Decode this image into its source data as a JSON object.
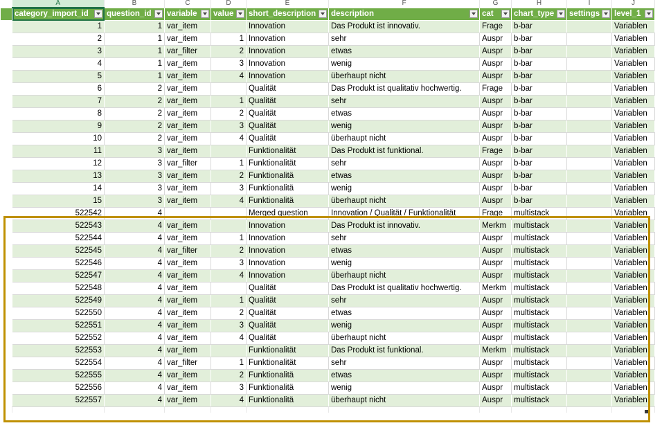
{
  "column_letters": [
    "A",
    "B",
    "C",
    "D",
    "E",
    "F",
    "G",
    "H",
    "I",
    "J"
  ],
  "headers": [
    "category_import_id",
    "question_id",
    "variable",
    "value",
    "short_description",
    "description",
    "cat",
    "chart_type",
    "settings",
    "level_1"
  ],
  "row_numbers": [
    "",
    "",
    "",
    "",
    "",
    "",
    "",
    "",
    ")",
    "",
    "",
    "",
    "",
    "",
    "",
    "",
    ""
  ],
  "rows": [
    {
      "category_import_id": "1",
      "question_id": "1",
      "variable": "var_item",
      "value": "",
      "short_description": "Innovation",
      "description": "Das Produkt ist innovativ.",
      "cat": "Frage",
      "chart_type": "b-bar",
      "settings": "",
      "level_1": "Variablen"
    },
    {
      "category_import_id": "2",
      "question_id": "1",
      "variable": "var_item",
      "value": "1",
      "short_description": "Innovation",
      "description": "sehr",
      "cat": "Auspr",
      "chart_type": "b-bar",
      "settings": "",
      "level_1": "Variablen"
    },
    {
      "category_import_id": "3",
      "question_id": "1",
      "variable": "var_filter",
      "value": "2",
      "short_description": "Innovation",
      "description": "etwas",
      "cat": "Auspr",
      "chart_type": "b-bar",
      "settings": "",
      "level_1": "Variablen"
    },
    {
      "category_import_id": "4",
      "question_id": "1",
      "variable": "var_item",
      "value": "3",
      "short_description": "Innovation",
      "description": "wenig",
      "cat": "Auspr",
      "chart_type": "b-bar",
      "settings": "",
      "level_1": "Variablen"
    },
    {
      "category_import_id": "5",
      "question_id": "1",
      "variable": "var_item",
      "value": "4",
      "short_description": "Innovation",
      "description": "überhaupt nicht",
      "cat": "Auspr",
      "chart_type": "b-bar",
      "settings": "",
      "level_1": "Variablen"
    },
    {
      "category_import_id": "6",
      "question_id": "2",
      "variable": "var_item",
      "value": "",
      "short_description": "Qualität",
      "description": "Das Produkt ist qualitativ hochwertig.",
      "cat": "Frage",
      "chart_type": "b-bar",
      "settings": "",
      "level_1": "Variablen"
    },
    {
      "category_import_id": "7",
      "question_id": "2",
      "variable": "var_item",
      "value": "1",
      "short_description": "Qualität",
      "description": "sehr",
      "cat": "Auspr",
      "chart_type": "b-bar",
      "settings": "",
      "level_1": "Variablen"
    },
    {
      "category_import_id": "8",
      "question_id": "2",
      "variable": "var_item",
      "value": "2",
      "short_description": "Qualität",
      "description": "etwas",
      "cat": "Auspr",
      "chart_type": "b-bar",
      "settings": "",
      "level_1": "Variablen"
    },
    {
      "category_import_id": "9",
      "question_id": "2",
      "variable": "var_item",
      "value": "3",
      "short_description": "Qualität",
      "description": "wenig",
      "cat": "Auspr",
      "chart_type": "b-bar",
      "settings": "",
      "level_1": "Variablen"
    },
    {
      "category_import_id": "10",
      "question_id": "2",
      "variable": "var_item",
      "value": "4",
      "short_description": "Qualität",
      "description": "überhaupt nicht",
      "cat": "Auspr",
      "chart_type": "b-bar",
      "settings": "",
      "level_1": "Variablen"
    },
    {
      "category_import_id": "11",
      "question_id": "3",
      "variable": "var_item",
      "value": "",
      "short_description": "Funktionalität",
      "description": "Das Produkt ist funktional.",
      "cat": "Frage",
      "chart_type": "b-bar",
      "settings": "",
      "level_1": "Variablen"
    },
    {
      "category_import_id": "12",
      "question_id": "3",
      "variable": "var_filter",
      "value": "1",
      "short_description": "Funktionalität",
      "description": "sehr",
      "cat": "Auspr",
      "chart_type": "b-bar",
      "settings": "",
      "level_1": "Variablen"
    },
    {
      "category_import_id": "13",
      "question_id": "3",
      "variable": "var_item",
      "value": "2",
      "short_description": "Funktionalitä",
      "description": "etwas",
      "cat": "Auspr",
      "chart_type": "b-bar",
      "settings": "",
      "level_1": "Variablen"
    },
    {
      "category_import_id": "14",
      "question_id": "3",
      "variable": "var_item",
      "value": "3",
      "short_description": "Funktionalitä",
      "description": "wenig",
      "cat": "Auspr",
      "chart_type": "b-bar",
      "settings": "",
      "level_1": "Variablen"
    },
    {
      "category_import_id": "15",
      "question_id": "3",
      "variable": "var_item",
      "value": "4",
      "short_description": "Funktionalitä",
      "description": "überhaupt nicht",
      "cat": "Auspr",
      "chart_type": "b-bar",
      "settings": "",
      "level_1": "Variablen"
    },
    {
      "category_import_id": "522542",
      "question_id": "4",
      "variable": "",
      "value": "",
      "short_description": "Merged question",
      "description": "Innovation / Qualität / Funktionalität",
      "cat": "Frage",
      "chart_type": "multistack",
      "settings": "",
      "level_1": "Variablen"
    },
    {
      "category_import_id": "522543",
      "question_id": "4",
      "variable": "var_item",
      "value": "",
      "short_description": "Innovation",
      "description": "Das Produkt ist innovativ.",
      "cat": "Merkm",
      "chart_type": "multistack",
      "settings": "",
      "level_1": "Variablen"
    },
    {
      "category_import_id": "522544",
      "question_id": "4",
      "variable": "var_item",
      "value": "1",
      "short_description": "Innovation",
      "description": "sehr",
      "cat": "Auspr",
      "chart_type": "multistack",
      "settings": "",
      "level_1": "Variablen"
    },
    {
      "category_import_id": "522545",
      "question_id": "4",
      "variable": "var_filter",
      "value": "2",
      "short_description": "Innovation",
      "description": "etwas",
      "cat": "Auspr",
      "chart_type": "multistack",
      "settings": "",
      "level_1": "Variablen"
    },
    {
      "category_import_id": "522546",
      "question_id": "4",
      "variable": "var_item",
      "value": "3",
      "short_description": "Innovation",
      "description": "wenig",
      "cat": "Auspr",
      "chart_type": "multistack",
      "settings": "",
      "level_1": "Variablen"
    },
    {
      "category_import_id": "522547",
      "question_id": "4",
      "variable": "var_item",
      "value": "4",
      "short_description": "Innovation",
      "description": "überhaupt nicht",
      "cat": "Auspr",
      "chart_type": "multistack",
      "settings": "",
      "level_1": "Variablen"
    },
    {
      "category_import_id": "522548",
      "question_id": "4",
      "variable": "var_item",
      "value": "",
      "short_description": "Qualität",
      "description": "Das Produkt ist qualitativ hochwertig.",
      "cat": "Merkm",
      "chart_type": "multistack",
      "settings": "",
      "level_1": "Variablen"
    },
    {
      "category_import_id": "522549",
      "question_id": "4",
      "variable": "var_item",
      "value": "1",
      "short_description": "Qualität",
      "description": "sehr",
      "cat": "Auspr",
      "chart_type": "multistack",
      "settings": "",
      "level_1": "Variablen"
    },
    {
      "category_import_id": "522550",
      "question_id": "4",
      "variable": "var_item",
      "value": "2",
      "short_description": "Qualität",
      "description": "etwas",
      "cat": "Auspr",
      "chart_type": "multistack",
      "settings": "",
      "level_1": "Variablen"
    },
    {
      "category_import_id": "522551",
      "question_id": "4",
      "variable": "var_item",
      "value": "3",
      "short_description": "Qualität",
      "description": "wenig",
      "cat": "Auspr",
      "chart_type": "multistack",
      "settings": "",
      "level_1": "Variablen"
    },
    {
      "category_import_id": "522552",
      "question_id": "4",
      "variable": "var_item",
      "value": "4",
      "short_description": "Qualität",
      "description": "überhaupt nicht",
      "cat": "Auspr",
      "chart_type": "multistack",
      "settings": "",
      "level_1": "Variablen"
    },
    {
      "category_import_id": "522553",
      "question_id": "4",
      "variable": "var_item",
      "value": "",
      "short_description": "Funktionalität",
      "description": "Das Produkt ist funktional.",
      "cat": "Merkm",
      "chart_type": "multistack",
      "settings": "",
      "level_1": "Variablen"
    },
    {
      "category_import_id": "522554",
      "question_id": "4",
      "variable": "var_filter",
      "value": "1",
      "short_description": "Funktionalität",
      "description": "sehr",
      "cat": "Auspr",
      "chart_type": "multistack",
      "settings": "",
      "level_1": "Variablen"
    },
    {
      "category_import_id": "522555",
      "question_id": "4",
      "variable": "var_item",
      "value": "2",
      "short_description": "Funktionalitä",
      "description": "etwas",
      "cat": "Auspr",
      "chart_type": "multistack",
      "settings": "",
      "level_1": "Variablen"
    },
    {
      "category_import_id": "522556",
      "question_id": "4",
      "variable": "var_item",
      "value": "3",
      "short_description": "Funktionalitä",
      "description": "wenig",
      "cat": "Auspr",
      "chart_type": "multistack",
      "settings": "",
      "level_1": "Variablen"
    },
    {
      "category_import_id": "522557",
      "question_id": "4",
      "variable": "var_item",
      "value": "4",
      "short_description": "Funktionalitä",
      "description": "überhaupt nicht",
      "cat": "Auspr",
      "chart_type": "multistack",
      "settings": "",
      "level_1": "Variablen"
    }
  ],
  "colors": {
    "header_green": "#70ad47",
    "band_green": "#e2efda",
    "highlight_gold": "#bf9000",
    "select_green": "#217346"
  }
}
